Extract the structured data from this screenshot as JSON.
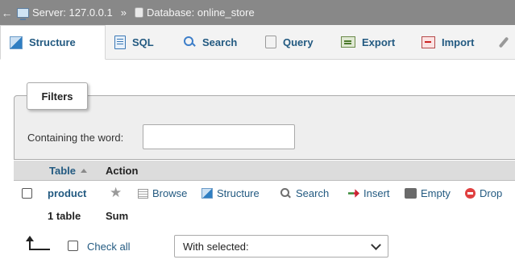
{
  "breadcrumb": {
    "back_glyph": "←",
    "server_label": "Server: 127.0.0.1",
    "separator": "»",
    "database_label": "Database: online_store"
  },
  "tabs": [
    {
      "label": "Structure",
      "icon": "structure-icon",
      "active": true
    },
    {
      "label": "SQL",
      "icon": "sql-icon"
    },
    {
      "label": "Search",
      "icon": "search-icon"
    },
    {
      "label": "Query",
      "icon": "query-icon"
    },
    {
      "label": "Export",
      "icon": "export-icon"
    },
    {
      "label": "Import",
      "icon": "import-icon"
    },
    {
      "label": "",
      "icon": "wrench-icon"
    }
  ],
  "filters": {
    "legend": "Filters",
    "label": "Containing the word:",
    "value": ""
  },
  "table_header": {
    "table": "Table",
    "action": "Action"
  },
  "rows": [
    {
      "name": "product",
      "actions": {
        "browse": "Browse",
        "structure": "Structure",
        "search": "Search",
        "insert": "Insert",
        "empty": "Empty",
        "drop": "Drop"
      }
    }
  ],
  "summary": {
    "count": "1 table",
    "label": "Sum"
  },
  "bulk": {
    "check_all": "Check all",
    "with_selected": "With selected:"
  },
  "colors": {
    "link": "#235a81",
    "topbar": "#888888",
    "tabbar": "#f3f3f3"
  }
}
